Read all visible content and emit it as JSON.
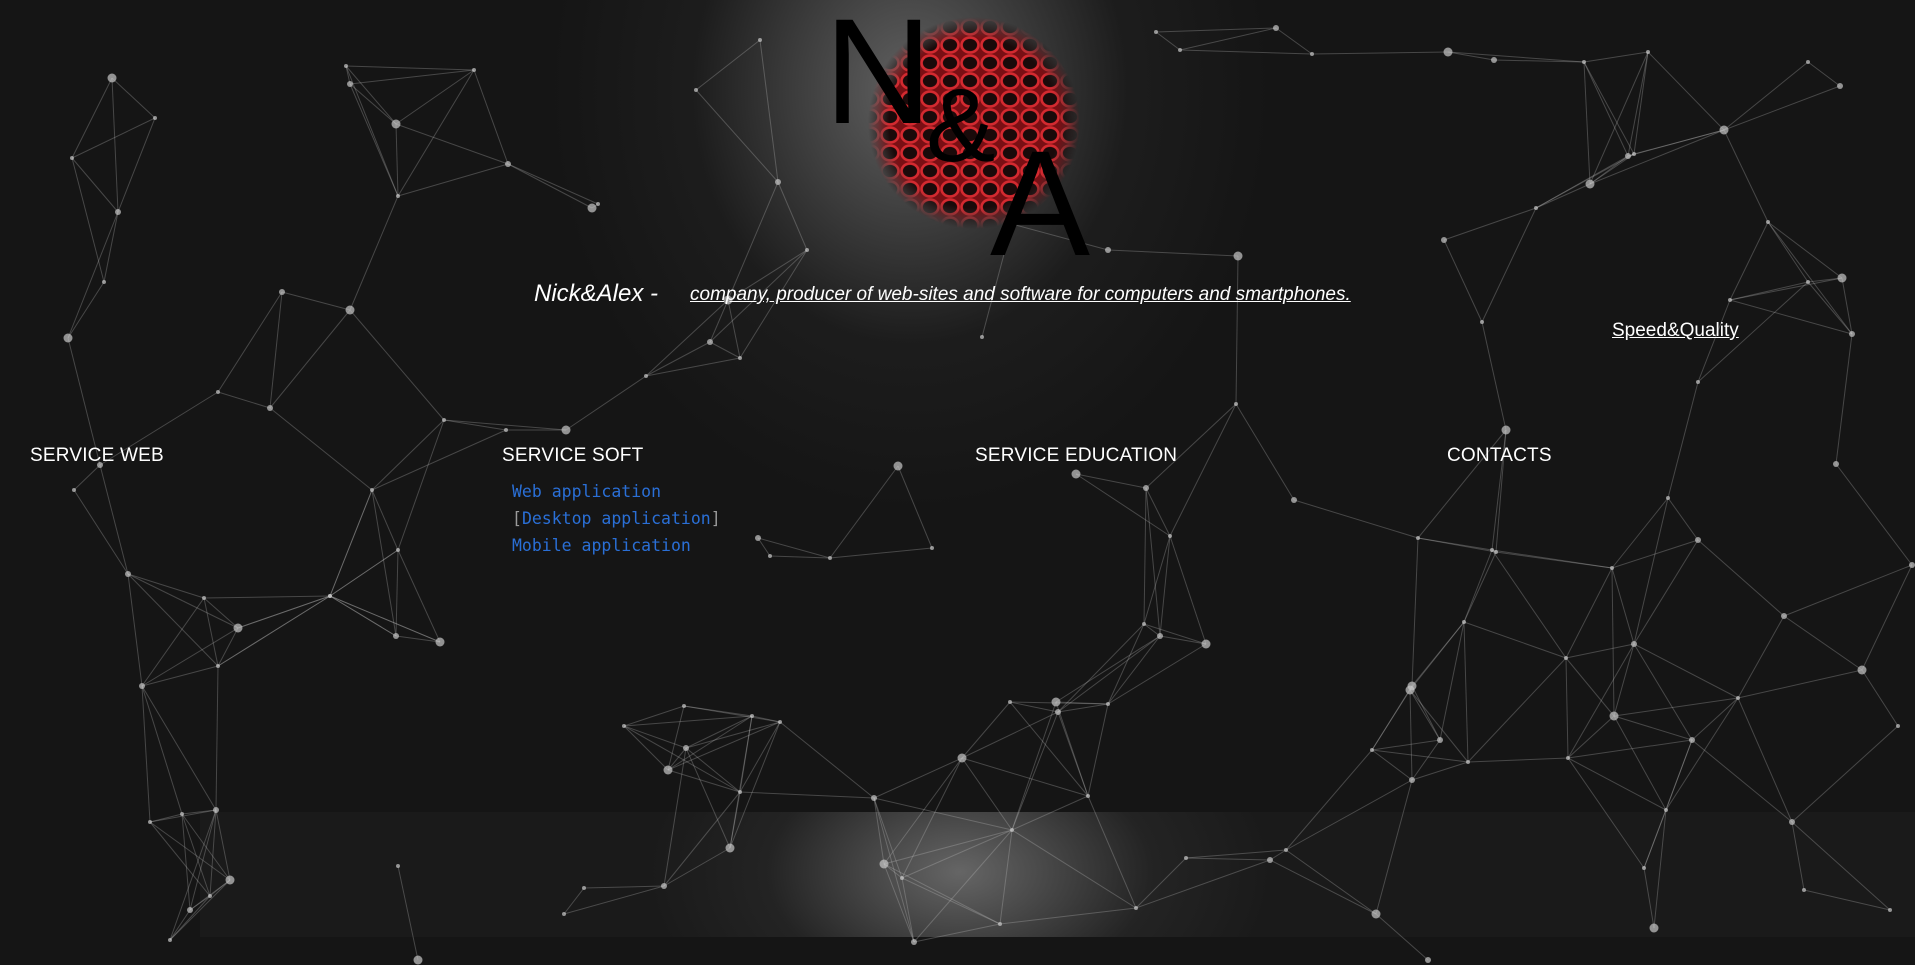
{
  "logo": {
    "letter_n": "N",
    "ampersand": "&",
    "letter_a": "A",
    "circle_color": "#c8202a"
  },
  "tagline": {
    "name": "Nick&Alex -",
    "description": "company, producer of web-sites and software for computers and smartphones."
  },
  "speed_link": "Speed&Quality",
  "nav": {
    "service_web": "SERVICE WEB",
    "service_soft": "SERVICE SOFT",
    "service_education": "SERVICE EDUCATION",
    "contacts": "CONTACTS"
  },
  "submenu": {
    "items": [
      "Web application",
      "Desktop application",
      "Mobile application"
    ],
    "selected": "Desktop application",
    "bracket_open": "[",
    "bracket_close": "]"
  },
  "colors": {
    "background": "#151515",
    "link": "#2a6fd6",
    "text": "#ffffff"
  }
}
